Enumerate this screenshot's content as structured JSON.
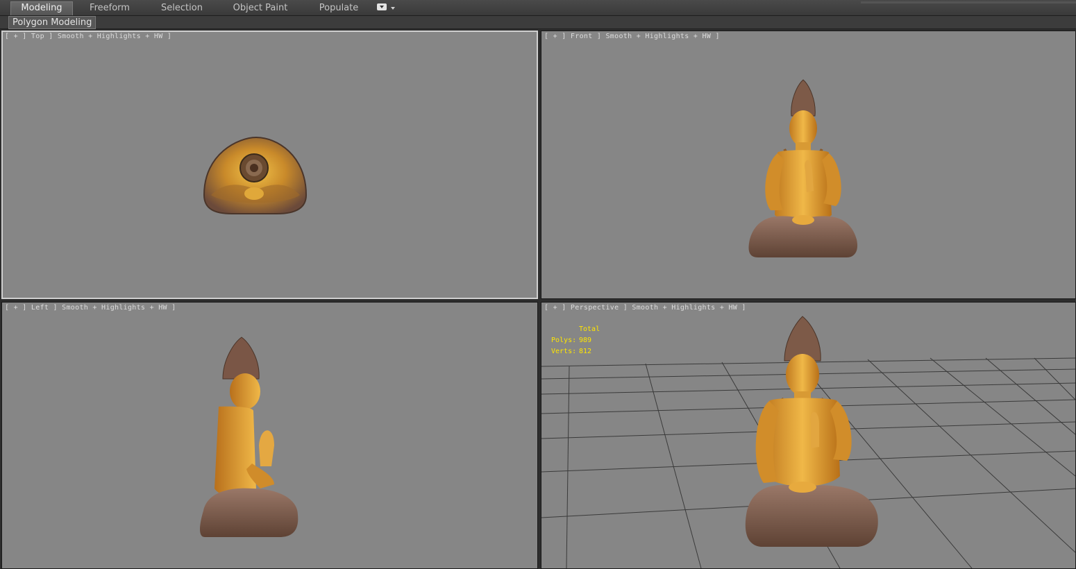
{
  "ribbon": {
    "tabs": [
      "Modeling",
      "Freeform",
      "Selection",
      "Object Paint",
      "Populate"
    ],
    "active_tab": "Modeling"
  },
  "panel": {
    "label": "Polygon Modeling"
  },
  "viewports": {
    "top": {
      "label": "[ + ] Top ] Smooth + Highlights + HW ]"
    },
    "front": {
      "label": "[ + ] Front ] Smooth + Highlights + HW ]"
    },
    "left": {
      "label": "[ + ] Left ] Smooth + Highlights + HW ]"
    },
    "perspective": {
      "label": "[ + ] Perspective ] Smooth + Highlights + HW ]"
    }
  },
  "stats": {
    "header": "Total",
    "polys_label": "Polys:",
    "polys": "989",
    "verts_label": "Verts:",
    "verts": "812"
  },
  "colors": {
    "viewport_bg": "#868686",
    "stats_text": "#ffe600",
    "gold": "#d9962a",
    "bronze": "#7a5a4a",
    "active_border": "#cfcfcf"
  }
}
